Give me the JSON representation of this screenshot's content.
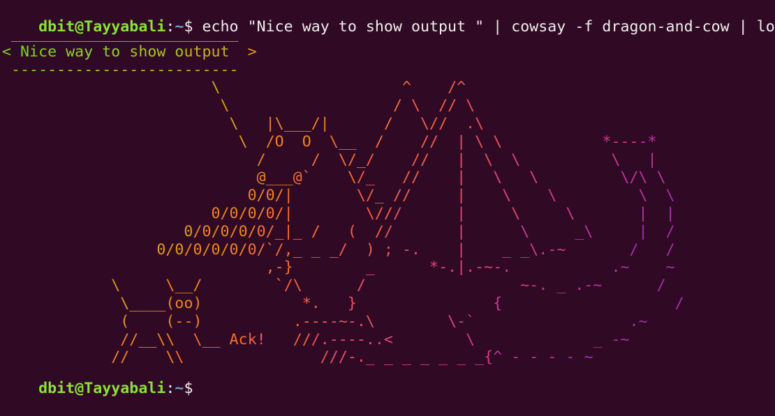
{
  "prompt": {
    "user_host": "dbit@Tayyabali",
    "separator": ":",
    "path": "~",
    "symbol": "$ ",
    "command": "echo \"Nice way to show output \" | cowsay -f dragon-and-cow | lolcat"
  },
  "output_lines": [
    " _________________________",
    "< Nice way to show output  >",
    " -------------------------",
    "                       \\                    ^    /^",
    "                        \\                  / \\  // \\",
    "                         \\   |\\___/|      /   \\//  .\\",
    "                          \\  /O  O  \\__  /    //  | \\ \\           *----*",
    "                            /     /  \\/_/    //   |  \\  \\          \\   |",
    "                            @___@`    \\/_   //    |   \\   \\         \\/\\ \\",
    "                           0/0/|       \\/_ //     |    \\    \\         \\  \\",
    "                       0/0/0/0/|        \\///      |     \\     \\       |  |",
    "                    0/0/0/0/0/_|_ /   (  //       |      \\     _\\     |  /",
    "                 0/0/0/0/0/0/`/,_ _ _/  ) ; -.    |    _ _\\.-~       /   /",
    "                             ,-}        _      *-.|.-~-.           .~    ~",
    "            \\     \\__/        `/\\      /                 ~-. _ .-~      /",
    "             \\____(oo)           *.   }               {                   /",
    "             (    (--)          .----~-.\\        \\-`                 .~",
    "             //__\\\\  \\__ Ack!   ///.----..<        \\             _ -~",
    "            //    \\\\               ///-._ _ _ _ _ _ _{^ - - - - ~"
  ],
  "palette": [
    "#7ed321",
    "#8fd12b",
    "#a5c51f",
    "#c4b21b",
    "#dd9b1c",
    "#ef8422",
    "#f76f32",
    "#f75f46",
    "#ef5060",
    "#e04478",
    "#cf3a8f",
    "#bd32a3",
    "#a92cb4"
  ],
  "final_prompt": {
    "user_host": "dbit@Tayyabali",
    "separator": ":",
    "path": "~",
    "symbol": "$ "
  }
}
